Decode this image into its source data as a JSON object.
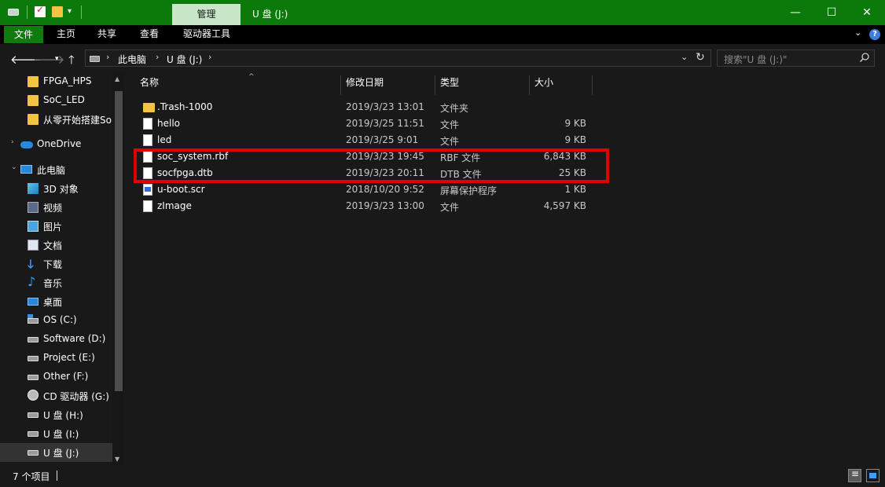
{
  "titlebar": {
    "manage_tab": "管理",
    "title": "U 盘 (J:)",
    "minimize": "—",
    "maximize": "☐",
    "close": "✕"
  },
  "ribbon": {
    "tabs": [
      "文件",
      "主页",
      "共享",
      "查看",
      "驱动器工具"
    ],
    "collapse": "⌄",
    "help": "?"
  },
  "address": {
    "crumbs": [
      "此电脑",
      "U 盘 (J:)"
    ],
    "search_placeholder": "搜索\"U 盘 (J:)\""
  },
  "sidebar": {
    "items": [
      {
        "label": "FPGA_HPS",
        "icon": "folder-icon"
      },
      {
        "label": "SoC_LED",
        "icon": "folder-icon"
      },
      {
        "label": "从零开始搭建So",
        "icon": "folder-icon"
      },
      {
        "label": "OneDrive",
        "icon": "onedrive-icon"
      },
      {
        "label": "此电脑",
        "icon": "computer-icon"
      },
      {
        "label": "3D 对象",
        "icon": "3d-objects-icon"
      },
      {
        "label": "视频",
        "icon": "video-icon"
      },
      {
        "label": "图片",
        "icon": "pictures-icon"
      },
      {
        "label": "文档",
        "icon": "documents-icon"
      },
      {
        "label": "下载",
        "icon": "download-icon"
      },
      {
        "label": "音乐",
        "icon": "music-icon"
      },
      {
        "label": "桌面",
        "icon": "desktop-icon"
      },
      {
        "label": "OS (C:)",
        "icon": "os-drive-icon"
      },
      {
        "label": "Software (D:)",
        "icon": "drive-icon"
      },
      {
        "label": "Project (E:)",
        "icon": "drive-icon"
      },
      {
        "label": "Other (F:)",
        "icon": "drive-icon"
      },
      {
        "label": "CD 驱动器 (G:)",
        "icon": "cd-drive-icon"
      },
      {
        "label": "U 盘 (H:)",
        "icon": "drive-icon"
      },
      {
        "label": "U 盘 (I:)",
        "icon": "drive-icon"
      },
      {
        "label": "U 盘 (J:)",
        "icon": "drive-icon",
        "selected": true
      }
    ]
  },
  "columns": [
    "名称",
    "修改日期",
    "类型",
    "大小"
  ],
  "files": [
    {
      "name": ".Trash-1000",
      "date": "2019/3/23 13:01",
      "type": "文件夹",
      "size": "",
      "icon": "folder-icon"
    },
    {
      "name": "hello",
      "date": "2019/3/25 11:51",
      "type": "文件",
      "size": "9 KB",
      "icon": "file-icon"
    },
    {
      "name": "led",
      "date": "2019/3/25 9:01",
      "type": "文件",
      "size": "9 KB",
      "icon": "file-icon"
    },
    {
      "name": "soc_system.rbf",
      "date": "2019/3/23 19:45",
      "type": "RBF 文件",
      "size": "6,843 KB",
      "icon": "file-icon"
    },
    {
      "name": "socfpga.dtb",
      "date": "2019/3/23 20:11",
      "type": "DTB 文件",
      "size": "25 KB",
      "icon": "file-icon"
    },
    {
      "name": "u-boot.scr",
      "date": "2018/10/20 9:52",
      "type": "屏幕保护程序",
      "size": "1 KB",
      "icon": "screensaver-file-icon"
    },
    {
      "name": "zImage",
      "date": "2019/3/23 13:00",
      "type": "文件",
      "size": "4,597 KB",
      "icon": "file-icon"
    }
  ],
  "status": {
    "item_count": "7 个项目"
  },
  "colors": {
    "titlebar": "#0b7a0b",
    "highlight_box": "#e00000",
    "background": "#191919"
  }
}
